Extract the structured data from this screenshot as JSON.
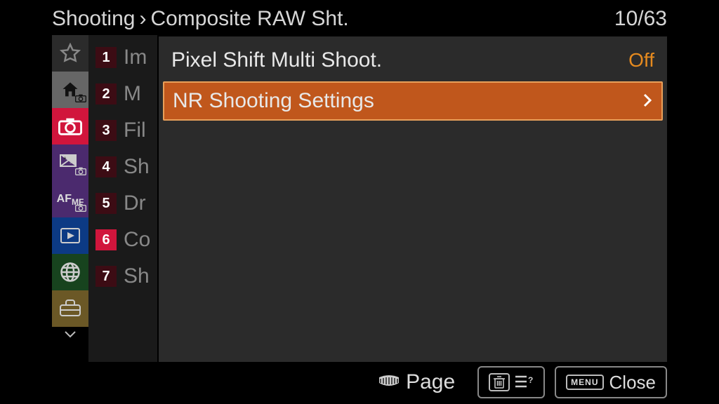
{
  "header": {
    "breadcrumb_root": "Shooting",
    "breadcrumb_leaf": "Composite RAW Sht.",
    "page_counter": "10/63"
  },
  "sublist": [
    {
      "num": "1",
      "text": "Im",
      "active": false
    },
    {
      "num": "2",
      "text": "M",
      "active": false
    },
    {
      "num": "3",
      "text": "Fil",
      "active": false
    },
    {
      "num": "4",
      "text": "Sh",
      "active": false
    },
    {
      "num": "5",
      "text": "Dr",
      "active": false
    },
    {
      "num": "6",
      "text": "Co",
      "active": true
    },
    {
      "num": "7",
      "text": "Sh",
      "active": false
    }
  ],
  "options": [
    {
      "label": "Pixel Shift Multi Shoot.",
      "value": "Off",
      "selected": false
    },
    {
      "label": "NR Shooting Settings",
      "value": "",
      "selected": true
    }
  ],
  "footer": {
    "page_label": "Page",
    "help_label": "",
    "close_label": "Close",
    "menu_word": "MENU"
  }
}
